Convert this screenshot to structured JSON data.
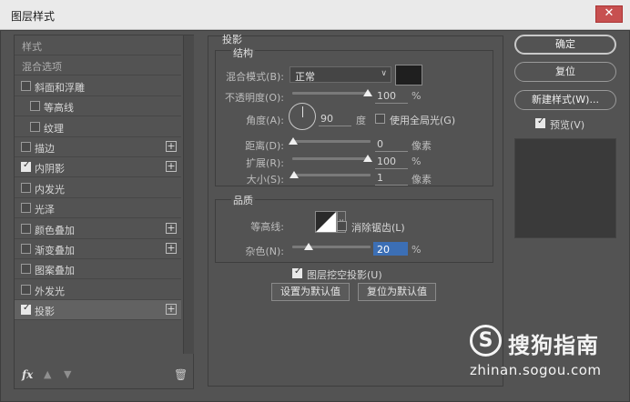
{
  "window": {
    "title": "图层样式",
    "close_glyph": "✕"
  },
  "styles_list": {
    "items": [
      {
        "label": "样式",
        "kind": "plain"
      },
      {
        "label": "混合选项",
        "kind": "plain"
      },
      {
        "label": "斜面和浮雕",
        "checked": false
      },
      {
        "label": "等高线",
        "checked": false,
        "indent": true
      },
      {
        "label": "纹理",
        "checked": false,
        "indent": true
      },
      {
        "label": "描边",
        "checked": false,
        "plus": "+"
      },
      {
        "label": "内阴影",
        "checked": true,
        "plus": "+"
      },
      {
        "label": "内发光",
        "checked": false
      },
      {
        "label": "光泽",
        "checked": false
      },
      {
        "label": "颜色叠加",
        "checked": false,
        "plus": "+"
      },
      {
        "label": "渐变叠加",
        "checked": false,
        "plus": "+"
      },
      {
        "label": "图案叠加",
        "checked": false
      },
      {
        "label": "外发光",
        "checked": false
      },
      {
        "label": "投影",
        "checked": true,
        "plus": "+",
        "selected": true
      }
    ],
    "footer": {
      "fx": "fx",
      "up_icon": "▲",
      "down_icon": "▼",
      "trash_icon": "🗑"
    }
  },
  "drop_shadow": {
    "title": "投影",
    "structure": {
      "title": "结构",
      "blend_mode_label": "混合模式(B):",
      "blend_mode_value": "正常",
      "shadow_color": "#1f1f1f",
      "opacity_label": "不透明度(O):",
      "opacity_value": "100",
      "opacity_unit": "%",
      "angle_label": "角度(A):",
      "angle_value": "90",
      "angle_unit": "度",
      "global_light_label": "使用全局光(G)",
      "global_light_checked": false,
      "distance_label": "距离(D):",
      "distance_value": "0",
      "distance_unit": "像素",
      "spread_label": "扩展(R):",
      "spread_value": "100",
      "spread_unit": "%",
      "size_label": "大小(S):",
      "size_value": "1",
      "size_unit": "像素"
    },
    "quality": {
      "title": "品质",
      "contour_label": "等高线:",
      "antialias_label": "消除锯齿(L)",
      "antialias_checked": false,
      "noise_label": "杂色(N):",
      "noise_value": "20",
      "noise_unit": "%"
    },
    "knockout_label": "图层挖空投影(U)",
    "knockout_checked": true,
    "make_default": "设置为默认值",
    "reset_default": "复位为默认值"
  },
  "side_buttons": {
    "ok": "确定",
    "reset": "复位",
    "new_style": "新建样式(W)...",
    "preview_label": "预览(V)",
    "preview_checked": true
  },
  "watermark": {
    "logo": "S",
    "brand": "搜狗指南",
    "url": "zhinan.sogou.com"
  }
}
